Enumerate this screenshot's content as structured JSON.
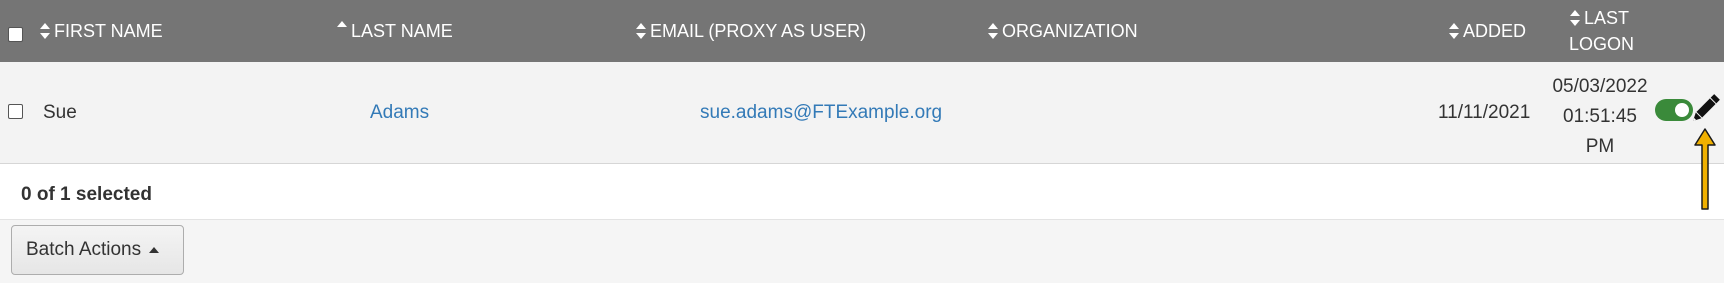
{
  "table": {
    "headers": {
      "first_name": "FIRST NAME",
      "last_name": "LAST NAME",
      "email": "EMAIL (PROXY AS USER)",
      "organization": "ORGANIZATION",
      "added": "ADDED",
      "last_logon_1": "LAST",
      "last_logon_2": "LOGON"
    },
    "rows": [
      {
        "first_name": "Sue",
        "last_name": "Adams",
        "email": "sue.adams@FTExample.org",
        "organization": "",
        "added": "11/11/2021",
        "last_logon_date": "05/03/2022",
        "last_logon_time": "01:51:45",
        "last_logon_ampm": "PM",
        "active": true
      }
    ],
    "sort": {
      "last_name": "ascending"
    }
  },
  "footer": {
    "selected_count": "0 of 1 selected",
    "batch_actions_label": "Batch Actions"
  },
  "colors": {
    "header_bg": "#757575",
    "row_bg": "#f3f3f3",
    "link": "#337ab7",
    "toggle_on": "#3a8a3a",
    "annotation_arrow": "#f0b000"
  },
  "icons": {
    "sort": "sort-both-icon",
    "sort_asc": "sort-ascending-icon",
    "edit": "pencil-icon",
    "toggle": "toggle-switch-icon",
    "annotation": "arrow-up-annotation"
  }
}
